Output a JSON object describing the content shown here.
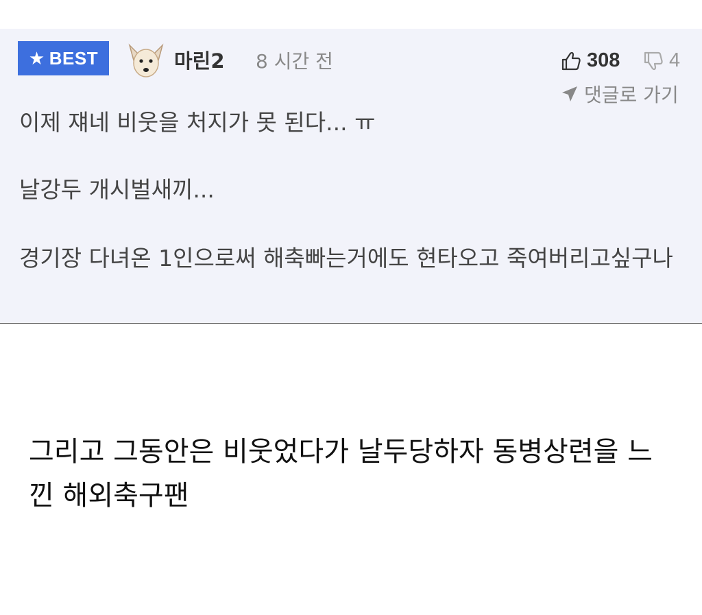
{
  "comment": {
    "badge_label": "BEST",
    "username": "마린2",
    "timestamp": "8 시간 전",
    "likes": "308",
    "dislikes": "4",
    "goto_label": "댓글로 가기",
    "lines": [
      "이제 쟤네 비웃을 처지가 못 된다... ㅠ",
      "날강두 개시벌새끼...",
      "경기장 다녀온 1인으로써 해축빠는거에도 현타오고 죽여버리고싶구나"
    ]
  },
  "caption": {
    "text": "그리고 그동안은 비웃었다가 날두당하자 동병상련을 느낀 해외축구팬"
  },
  "icons": {
    "star": "star-icon",
    "avatar": "dog-avatar",
    "like": "thumbs-up-icon",
    "dislike": "thumbs-down-icon",
    "goto": "arrow-icon"
  },
  "colors": {
    "badge": "#3d6fde",
    "card_bg": "#f2f3fa"
  }
}
